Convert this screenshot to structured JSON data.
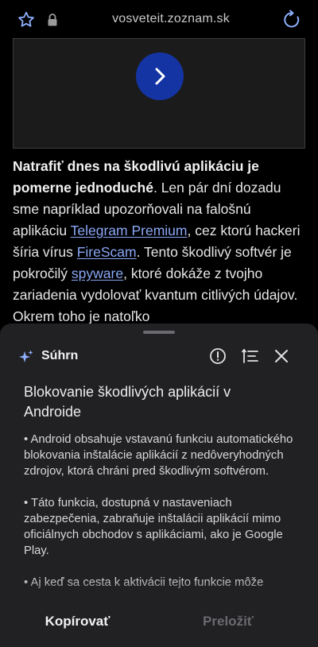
{
  "browser": {
    "url": "vosveteit.zoznam.sk"
  },
  "article": {
    "bold_intro": "Natrafiť dnes na škodlivú aplikáciu je pomerne jednoduché",
    "t1": ". Len pár dní dozadu sme napríklad upozorňovali na falošnú aplikáciu ",
    "link1": "Telegram Premium",
    "t2": ", cez ktorú hackeri šíria vírus ",
    "link2": "FireScam",
    "t3": ". Tento škodlivý softvér je pokročilý ",
    "link3": "spyware",
    "t4": ", ktoré dokáže z tvojho zariadenia vydolovať kvantum citlivých údajov. Okrem toho je natoľko"
  },
  "sheet": {
    "title": "Súhrn",
    "summary_title": "Blokovanie škodlivých aplikácií v Androide",
    "bullets": [
      "• Android obsahuje vstavanú funkciu automatického blokovania inštalácie aplikácií z nedôveryhodných zdrojov, ktorá chráni pred škodlivým softvérom.",
      "• Táto funkcia, dostupná v nastaveniach zabezpečenia, zabraňuje inštalácii aplikácií mimo oficiálnych obchodov s aplikáciami, ako je Google Play.",
      "• Aj keď sa cesta k aktivácii tejto funkcie môže"
    ],
    "copy_label": "Kopírovať",
    "translate_label": "Preložiť"
  },
  "colors": {
    "link": "#8aa7f5",
    "play_button": "#1434a4",
    "accent_icon": "#8fb0ff",
    "sheet_bg": "#212124"
  },
  "icons": {
    "bookmark": "star-icon",
    "secure": "lock-icon",
    "reload": "reload-icon",
    "play": "chevron-right-icon",
    "summary": "sparkle-icon",
    "info": "info-icon",
    "format": "list-icon",
    "close": "close-icon"
  }
}
